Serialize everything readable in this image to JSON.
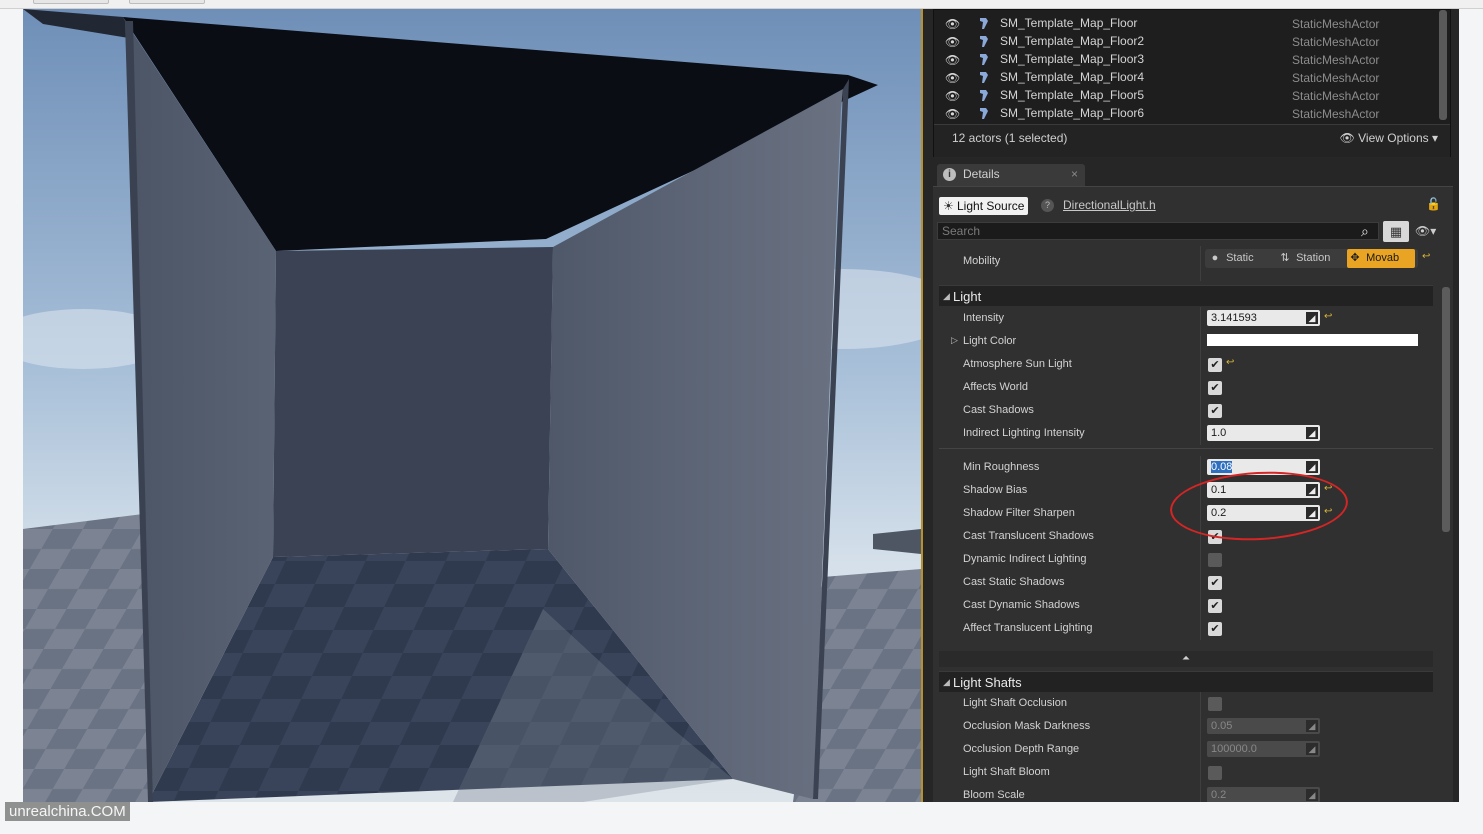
{
  "outliner": {
    "rows": [
      {
        "name": "SM_Template_Map_Floor",
        "type": "StaticMeshActor"
      },
      {
        "name": "SM_Template_Map_Floor2",
        "type": "StaticMeshActor"
      },
      {
        "name": "SM_Template_Map_Floor3",
        "type": "StaticMeshActor"
      },
      {
        "name": "SM_Template_Map_Floor4",
        "type": "StaticMeshActor"
      },
      {
        "name": "SM_Template_Map_Floor5",
        "type": "StaticMeshActor"
      },
      {
        "name": "SM_Template_Map_Floor6",
        "type": "StaticMeshActor"
      }
    ],
    "actors_count": "12 actors (1 selected)",
    "view_options": "View Options"
  },
  "details": {
    "tab_label": "Details",
    "component_label": "Light Source",
    "source_link": "DirectionalLight.h",
    "search_placeholder": "Search",
    "mobility": {
      "label": "Mobility",
      "options": [
        "Static",
        "Station",
        "Movab"
      ],
      "selected": "Movab"
    },
    "light_category": "Light",
    "light_rows": [
      {
        "label": "Intensity",
        "kind": "num",
        "value": "3.141593",
        "reset": true
      },
      {
        "label": "Light Color",
        "kind": "color",
        "value": "#FFFFFF"
      },
      {
        "label": "Atmosphere Sun Light",
        "kind": "check",
        "checked": true,
        "reset": true
      },
      {
        "label": "Affects World",
        "kind": "check",
        "checked": true
      },
      {
        "label": "Cast Shadows",
        "kind": "check",
        "checked": true
      },
      {
        "label": "Indirect Lighting Intensity",
        "kind": "num",
        "value": "1.0"
      }
    ],
    "advanced_rows": [
      {
        "label": "Min Roughness",
        "kind": "num",
        "value": "0.08",
        "selected": true
      },
      {
        "label": "Shadow Bias",
        "kind": "num",
        "value": "0.1",
        "reset": true
      },
      {
        "label": "Shadow Filter Sharpen",
        "kind": "num",
        "value": "0.2",
        "reset": true
      },
      {
        "label": "Cast Translucent Shadows",
        "kind": "check",
        "checked": true
      },
      {
        "label": "Dynamic Indirect Lighting",
        "kind": "check",
        "checked": false
      },
      {
        "label": "Cast Static Shadows",
        "kind": "check",
        "checked": true
      },
      {
        "label": "Cast Dynamic Shadows",
        "kind": "check",
        "checked": true
      },
      {
        "label": "Affect Translucent Lighting",
        "kind": "check",
        "checked": true
      }
    ],
    "shafts_category": "Light Shafts",
    "shaft_rows": [
      {
        "label": "Light Shaft Occlusion",
        "kind": "check",
        "checked": false
      },
      {
        "label": "Occlusion Mask Darkness",
        "kind": "numdim",
        "value": "0.05"
      },
      {
        "label": "Occlusion Depth Range",
        "kind": "numdim",
        "value": "100000.0"
      },
      {
        "label": "Light Shaft Bloom",
        "kind": "check",
        "checked": false
      },
      {
        "label": "Bloom Scale",
        "kind": "numdim",
        "value": "0.2"
      }
    ]
  },
  "watermark": "unrealchina.COM",
  "colors": {
    "accent": "#E8A422",
    "annotation": "#D52525",
    "panel": "#303030"
  }
}
